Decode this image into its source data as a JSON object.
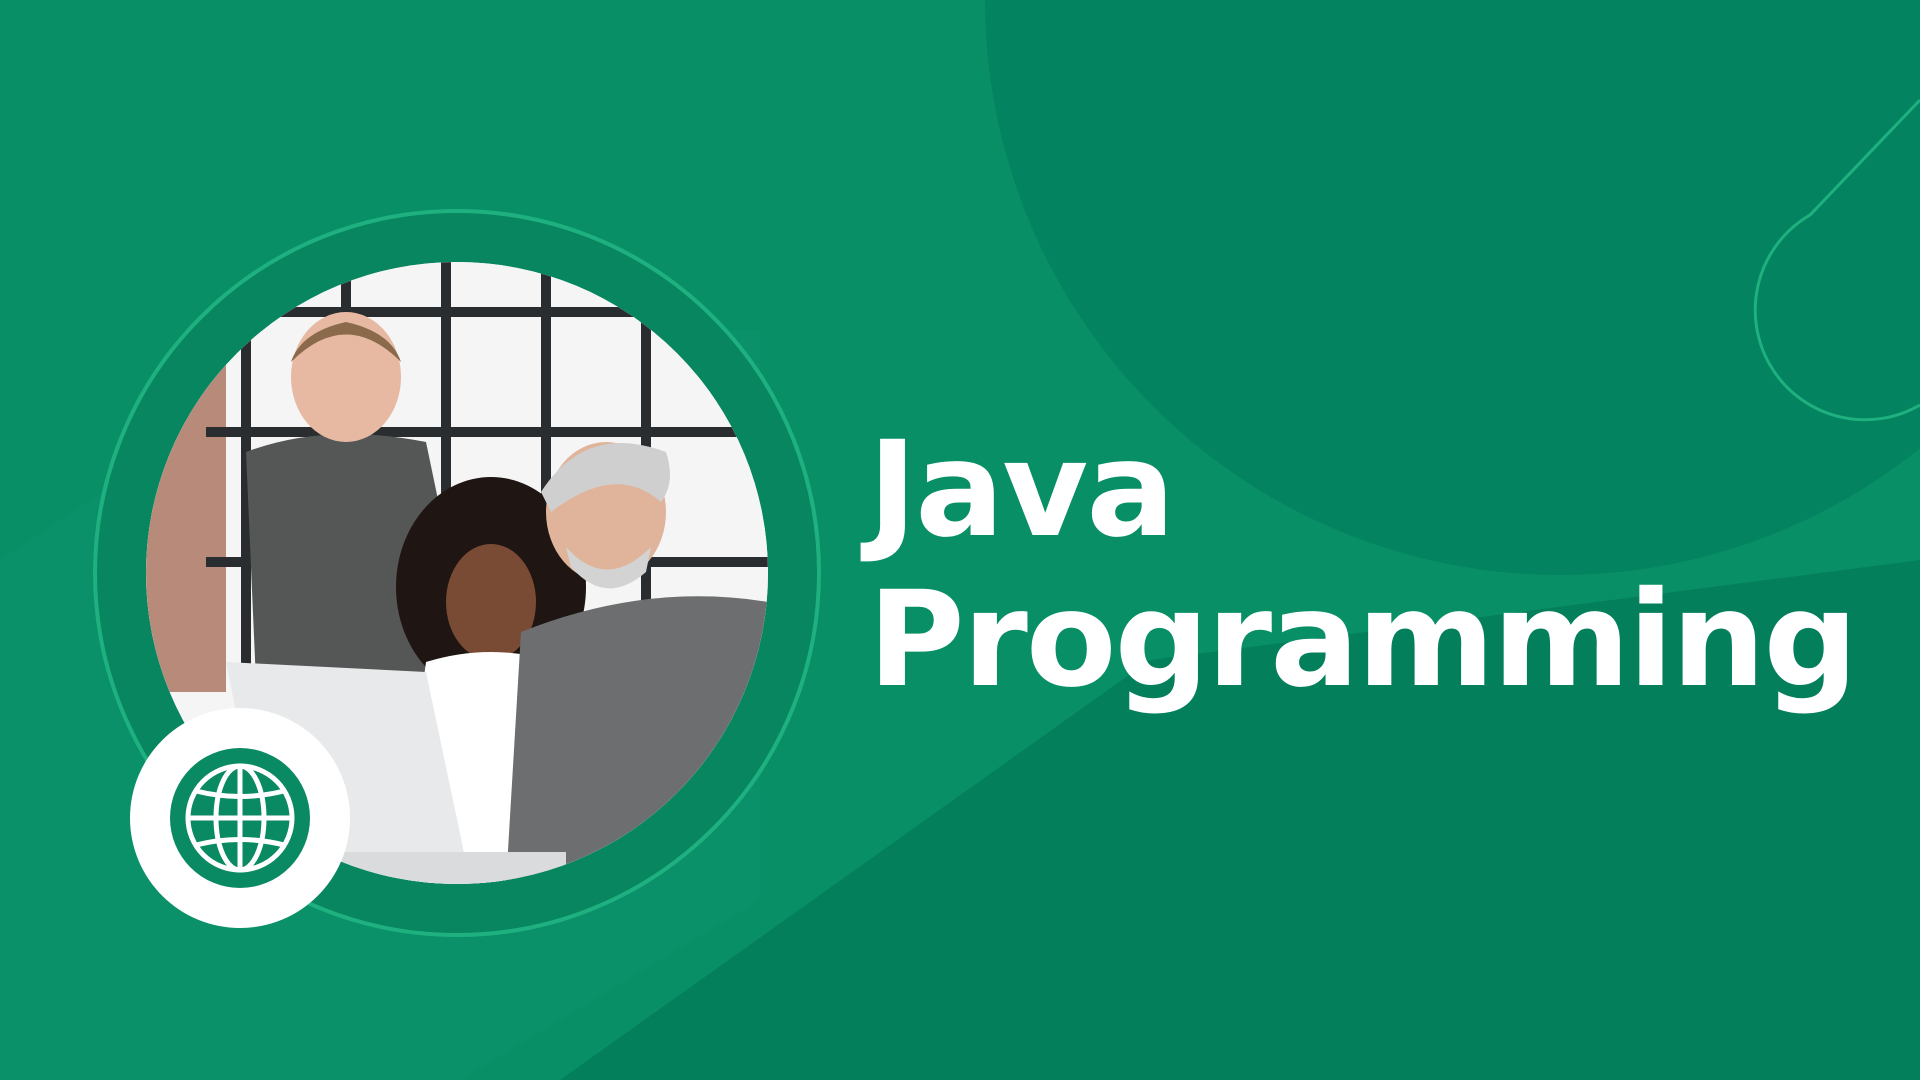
{
  "slide": {
    "title_line_1": "Java",
    "title_line_2": "Programming"
  },
  "colors": {
    "background": "#098f66",
    "background_dark": "#03835f",
    "accent_ring": "#1fb07f",
    "text": "#ffffff"
  },
  "icons": {
    "badge": "globe-icon"
  }
}
